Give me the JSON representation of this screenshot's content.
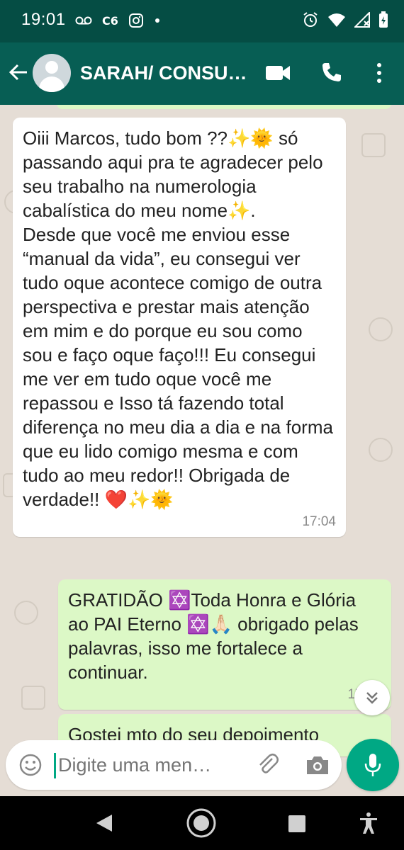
{
  "status_bar": {
    "time": "19:01",
    "left_icons": [
      "voicemail-icon",
      "c6-app-icon",
      "instagram-icon",
      "dot-icon"
    ],
    "c6_label": "C6",
    "right_icons": [
      "alarm-icon",
      "wifi-icon",
      "signal-icon",
      "battery-icon"
    ]
  },
  "header": {
    "title": "SARAH/ CONSUL…",
    "icons": [
      "back-arrow-icon",
      "avatar",
      "video-call-icon",
      "phone-call-icon",
      "more-options-icon"
    ]
  },
  "messages": [
    {
      "direction": "incoming",
      "text": "Oiii Marcos, tudo bom ??✨🌞 só passando aqui pra te agradecer pelo seu trabalho na numerologia cabalística do meu nome✨.\nDesde que você me enviou esse “manual da vida”, eu consegui ver tudo oque acontece comigo de outra perspectiva e prestar mais atenção em mim e do porque eu sou como sou e faço oque faço!!! Eu consegui me ver em tudo oque você me repassou e Isso tá fazendo total diferença no meu dia a dia e na forma que eu lido comigo mesma e com tudo ao meu redor!! Obrigada de verdade!! ❤️✨🌞",
      "time": "17:04"
    },
    {
      "direction": "outgoing",
      "text": "GRATIDÃO ✡️Toda Honra e Glória ao PAI Eterno ✡️🙏🏻 obrigado pelas palavras, isso me fortalece a continuar.",
      "time": "17:45"
    },
    {
      "direction": "outgoing",
      "text": "Gostei mto do seu depoimento",
      "time": ""
    }
  ],
  "composer": {
    "placeholder": "Digite uma men…",
    "icons": [
      "emoji-icon",
      "attach-icon",
      "camera-icon",
      "mic-icon"
    ]
  },
  "colors": {
    "header": "#075e54",
    "status_bar": "#054d44",
    "chat_background": "#e5ddd5",
    "outgoing_bubble": "#dcf8c6",
    "incoming_bubble": "#ffffff",
    "accent": "#00a884"
  }
}
